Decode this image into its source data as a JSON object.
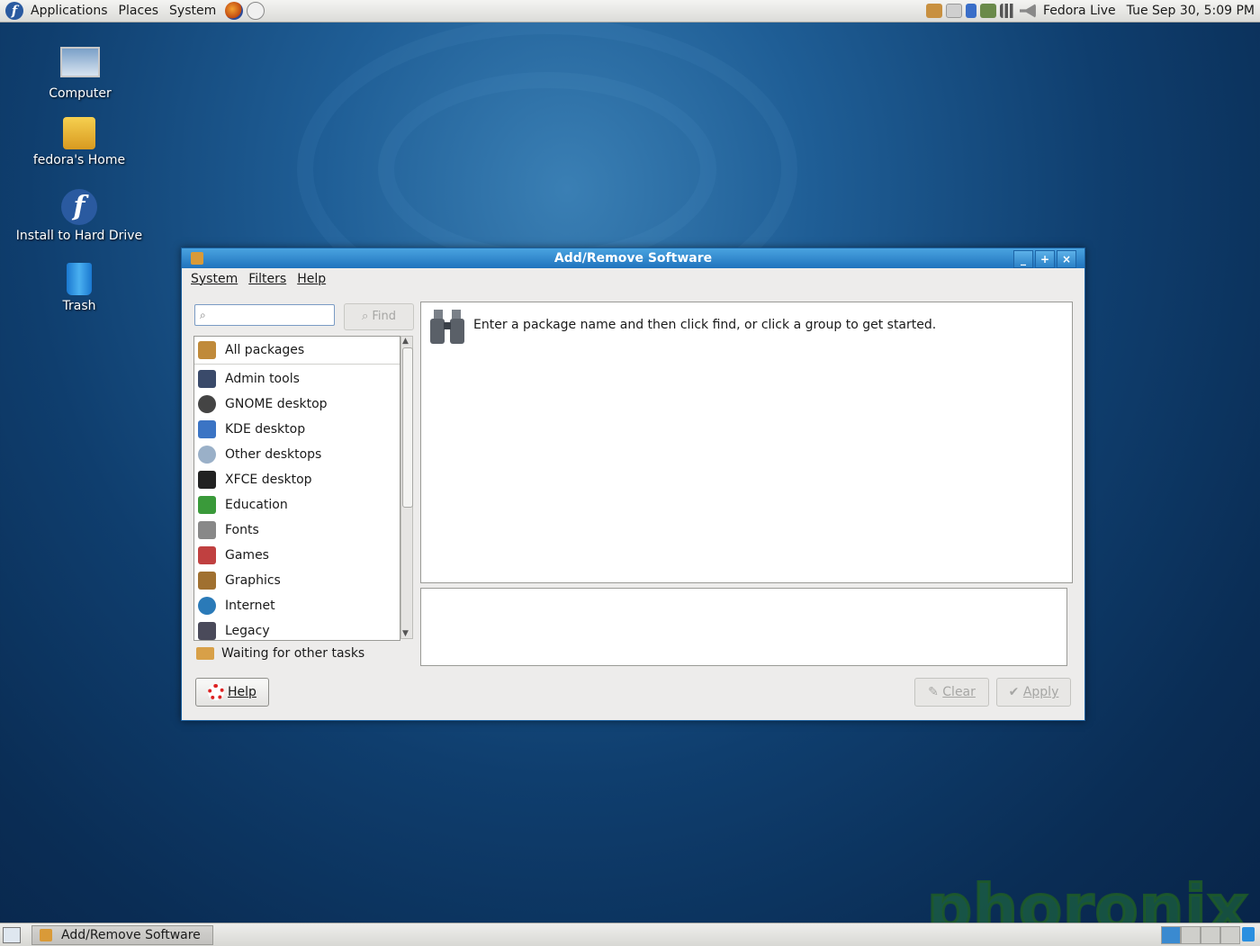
{
  "top_panel": {
    "menus": [
      "Applications",
      "Places",
      "System"
    ],
    "user": "Fedora Live",
    "clock": "Tue Sep 30,  5:09 PM"
  },
  "desktop_icons": [
    {
      "label": "Computer",
      "icon": "computer-icon"
    },
    {
      "label": "fedora's Home",
      "icon": "home-folder-icon"
    },
    {
      "label": "Install to Hard Drive",
      "icon": "fedora-install-icon"
    },
    {
      "label": "Trash",
      "icon": "trash-icon"
    }
  ],
  "window": {
    "title": "Add/Remove Software",
    "menus": [
      "System",
      "Filters",
      "Help"
    ],
    "search": {
      "value": "",
      "placeholder": ""
    },
    "find_label": "Find",
    "groups": [
      {
        "label": "All packages",
        "icon": "all-packages-icon",
        "color": "#c08a3a"
      },
      {
        "label": "Admin tools",
        "icon": "admin-tools-icon",
        "color": "#3a4a6a"
      },
      {
        "label": "GNOME desktop",
        "icon": "gnome-foot-icon",
        "color": "#444444"
      },
      {
        "label": "KDE desktop",
        "icon": "kde-icon",
        "color": "#3b74c4"
      },
      {
        "label": "Other desktops",
        "icon": "other-desktops-icon",
        "color": "#9ab0c8"
      },
      {
        "label": "XFCE desktop",
        "icon": "xfce-mouse-icon",
        "color": "#222222"
      },
      {
        "label": "Education",
        "icon": "education-icon",
        "color": "#3a9a3a"
      },
      {
        "label": "Fonts",
        "icon": "fonts-icon",
        "color": "#888888"
      },
      {
        "label": "Games",
        "icon": "games-icon",
        "color": "#c04040"
      },
      {
        "label": "Graphics",
        "icon": "graphics-icon",
        "color": "#a07030"
      },
      {
        "label": "Internet",
        "icon": "internet-globe-icon",
        "color": "#2a7ab8"
      },
      {
        "label": "Legacy",
        "icon": "legacy-icon",
        "color": "#4a4a5a"
      }
    ],
    "status": "Waiting for other tasks",
    "hint": "Enter a package name and then click find, or click a group to get started.",
    "help_label": "Help",
    "clear_label": "Clear",
    "apply_label": "Apply"
  },
  "bottom_panel": {
    "task": "Add/Remove Software"
  },
  "watermark": "phoronix"
}
